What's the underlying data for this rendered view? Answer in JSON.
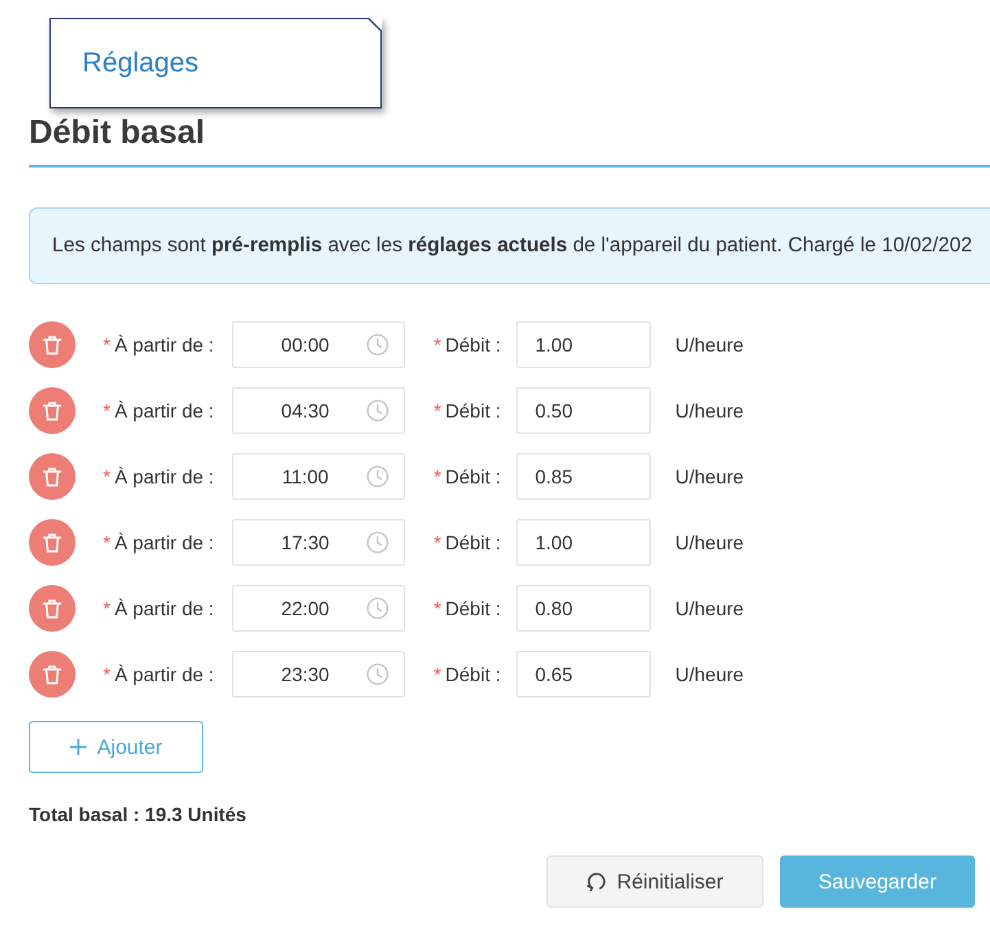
{
  "section_card": {
    "title": "Réglages"
  },
  "heading": "Débit basal",
  "info": "Les champs sont **pré-remplis** avec les **réglages actuels** de l'appareil du patient. Chargé le 10/02/202",
  "rows": [
    {
      "from_mark": "*",
      "from_label": "À partir de :",
      "time": "00:00",
      "rate_mark": "*",
      "rate_label": "Débit :",
      "rate": "1.00",
      "unit": "U/heure"
    },
    {
      "from_mark": "*",
      "from_label": "À partir de :",
      "time": "04:30",
      "rate_mark": "*",
      "rate_label": "Débit :",
      "rate": "0.50",
      "unit": "U/heure"
    },
    {
      "from_mark": "*",
      "from_label": "À partir de :",
      "time": "11:00",
      "rate_mark": "*",
      "rate_label": "Débit :",
      "rate": "0.85",
      "unit": "U/heure"
    },
    {
      "from_mark": "*",
      "from_label": "À partir de :",
      "time": "17:30",
      "rate_mark": "*",
      "rate_label": "Débit :",
      "rate": "1.00",
      "unit": "U/heure"
    },
    {
      "from_mark": "*",
      "from_label": "À partir de :",
      "time": "22:00",
      "rate_mark": "*",
      "rate_label": "Débit :",
      "rate": "0.80",
      "unit": "U/heure"
    },
    {
      "from_mark": "*",
      "from_label": "À partir de :",
      "time": "23:30",
      "rate_mark": "*",
      "rate_label": "Débit :",
      "rate": "0.65",
      "unit": "U/heure"
    }
  ],
  "add_button": {
    "label": "Ajouter"
  },
  "total": "Total basal : 19.3 Unités",
  "buttons": [
    {
      "kind": "secondary",
      "label": "Réinitialiser"
    },
    {
      "kind": "primary",
      "label": "Sauvegarder"
    }
  ]
}
